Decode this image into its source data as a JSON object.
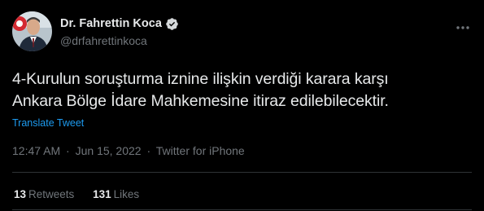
{
  "author": {
    "display_name": "Dr. Fahrettin Koca",
    "handle": "@drfahrettinkoca",
    "verified_icon": "verified-badge-icon",
    "avatar_icon": "profile-photo"
  },
  "tweet": {
    "text": "4-Kurulun soruşturma iznine ilişkin verdiği karara karşı\nAnkara Bölge İdare Mahkemesine itiraz edilebilecektir.",
    "translate_label": "Translate Tweet",
    "time": "12:47 AM",
    "date": "Jun 15, 2022",
    "source": "Twitter for iPhone",
    "separator": "·"
  },
  "stats": {
    "retweets_count": "13",
    "retweets_label": "Retweets",
    "likes_count": "131",
    "likes_label": "Likes"
  },
  "colors": {
    "background": "#000000",
    "text": "#e7e9ea",
    "secondary": "#71767b",
    "link": "#1d9bf0",
    "divider": "#2f3336"
  }
}
